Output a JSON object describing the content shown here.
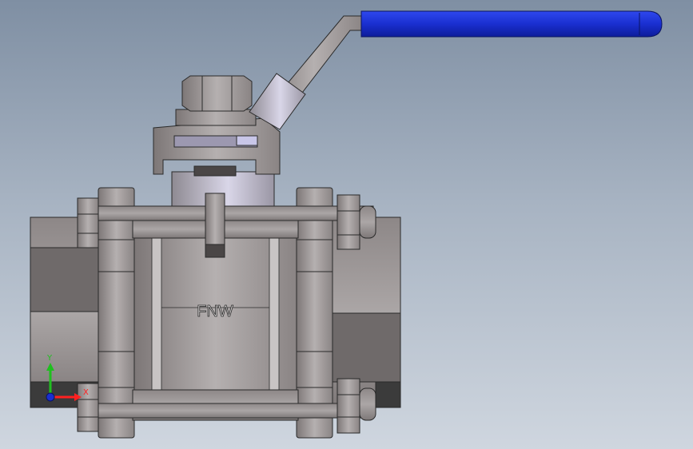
{
  "viewport": {
    "background_top": "#7f8fa3",
    "background_bottom": "#cfd6df"
  },
  "model": {
    "body_marking": "FNW",
    "handle_grip_color": "#1a2fd0",
    "metal_color": "#9a9494"
  },
  "triad": {
    "x_label": "X",
    "y_label": "Y",
    "x_color": "#ff2020",
    "y_color": "#1fbf1f",
    "z_color": "#1a2fd0"
  }
}
